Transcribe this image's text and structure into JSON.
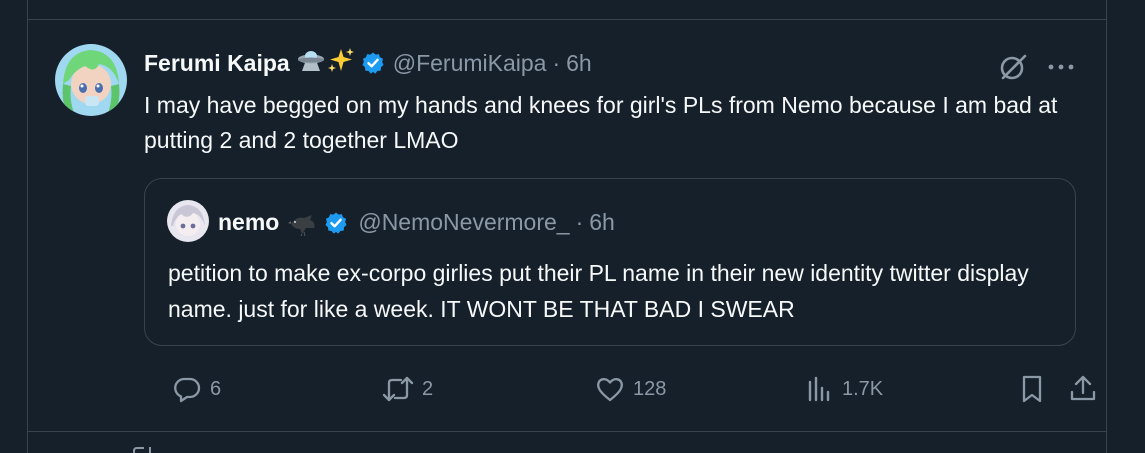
{
  "tweet": {
    "display_name": "Ferumi Kaipa",
    "name_emojis": [
      "ufo-emoji",
      "sparkles-emoji"
    ],
    "handle": "@FerumiKaipa",
    "separator": "·",
    "time": "6h",
    "text": "I may have begged on my hands and knees for girl's PLs from Nemo because I am bad at putting 2 and 2 together LMAO",
    "avatar_colors": {
      "hair": "#6fd67a",
      "skin": "#f2d3c2",
      "bg": "#9fd8f0"
    }
  },
  "quote": {
    "display_name": "nemo",
    "name_emoji": "crow-emoji",
    "handle": "@NemoNevermore_",
    "separator": "·",
    "time": "6h",
    "text": "petition to make ex-corpo girlies put their PL name in their new identity twitter display name. just for like a week. IT WONT BE THAT BAD I SWEAR"
  },
  "actions": {
    "replies": "6",
    "reposts": "2",
    "likes": "128",
    "views": "1.7K"
  },
  "colors": {
    "background": "#15202b",
    "border": "#38444d",
    "text_primary": "#f7f9f9",
    "text_secondary": "#8b98a5",
    "verified": "#1d9bf0"
  }
}
